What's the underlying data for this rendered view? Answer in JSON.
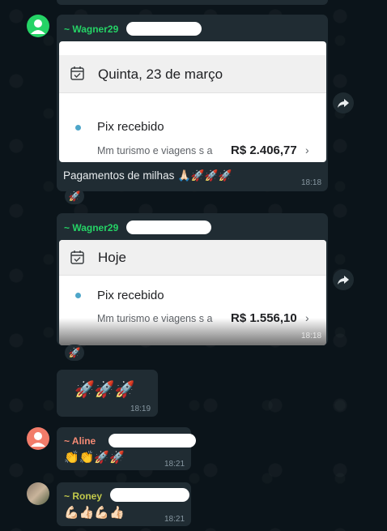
{
  "messages": [
    {
      "sender": "~ Wagner29",
      "card": {
        "date": "Quinta, 23 de março",
        "title": "Pix recebido",
        "description": "Mm turismo e viagens s a",
        "amount": "R$ 2.406,77"
      },
      "caption": "Pagamentos de milhas 🙏🏻🚀🚀🚀",
      "time": "18:18",
      "reaction": "🚀"
    },
    {
      "sender": "~ Wagner29",
      "card": {
        "date": "Hoje",
        "title": "Pix recebido",
        "description": "Mm turismo e viagens s a",
        "amount": "R$ 1.556,10"
      },
      "time": "18:18",
      "reaction": "🚀"
    },
    {
      "text": "🚀🚀🚀",
      "time": "18:19"
    },
    {
      "sender": "~ Aline",
      "text": "👏👏🚀🚀",
      "time": "18:21"
    },
    {
      "sender": "~ Roney",
      "text": "💪🏻👍🏻💪🏻👍🏻",
      "time": "18:21"
    }
  ],
  "icons": {
    "forward": "forward-icon",
    "calendar": "calendar-icon",
    "chevron": "chevron-right-icon"
  },
  "colors": {
    "background": "#0b141a",
    "bubble": "#202c33",
    "sender_green": "#25d366",
    "sender_orange": "#f68b75",
    "sender_olive": "#c2c94b"
  }
}
